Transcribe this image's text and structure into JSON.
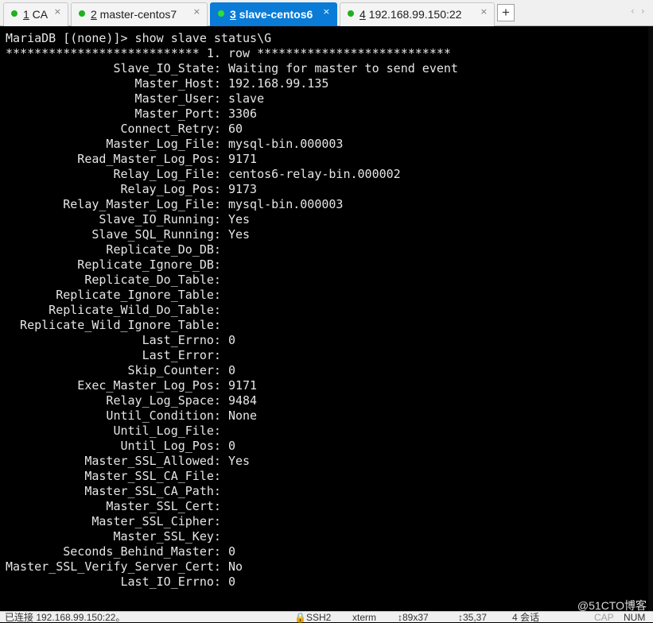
{
  "tabs": [
    {
      "num": "1",
      "title": " CA",
      "active": false
    },
    {
      "num": "2",
      "title": " master-centos7",
      "active": false
    },
    {
      "num": "3",
      "title": " slave-centos6",
      "active": true
    },
    {
      "num": "4",
      "title": " 192.168.99.150:22",
      "active": false
    }
  ],
  "tab_close": "×",
  "new_tab": "+",
  "nav": {
    "prev": "‹",
    "next": "›"
  },
  "terminal": {
    "prompt_line": "MariaDB [(none)]> show slave status\\G",
    "row_header": "*************************** 1. row ***************************",
    "fields": [
      {
        "key": "Slave_IO_State",
        "value": "Waiting for master to send event"
      },
      {
        "key": "Master_Host",
        "value": "192.168.99.135"
      },
      {
        "key": "Master_User",
        "value": "slave"
      },
      {
        "key": "Master_Port",
        "value": "3306"
      },
      {
        "key": "Connect_Retry",
        "value": "60"
      },
      {
        "key": "Master_Log_File",
        "value": "mysql-bin.000003"
      },
      {
        "key": "Read_Master_Log_Pos",
        "value": "9171"
      },
      {
        "key": "Relay_Log_File",
        "value": "centos6-relay-bin.000002"
      },
      {
        "key": "Relay_Log_Pos",
        "value": "9173"
      },
      {
        "key": "Relay_Master_Log_File",
        "value": "mysql-bin.000003"
      },
      {
        "key": "Slave_IO_Running",
        "value": "Yes"
      },
      {
        "key": "Slave_SQL_Running",
        "value": "Yes"
      },
      {
        "key": "Replicate_Do_DB",
        "value": ""
      },
      {
        "key": "Replicate_Ignore_DB",
        "value": ""
      },
      {
        "key": "Replicate_Do_Table",
        "value": ""
      },
      {
        "key": "Replicate_Ignore_Table",
        "value": ""
      },
      {
        "key": "Replicate_Wild_Do_Table",
        "value": ""
      },
      {
        "key": "Replicate_Wild_Ignore_Table",
        "value": ""
      },
      {
        "key": "Last_Errno",
        "value": "0"
      },
      {
        "key": "Last_Error",
        "value": ""
      },
      {
        "key": "Skip_Counter",
        "value": "0"
      },
      {
        "key": "Exec_Master_Log_Pos",
        "value": "9171"
      },
      {
        "key": "Relay_Log_Space",
        "value": "9484"
      },
      {
        "key": "Until_Condition",
        "value": "None"
      },
      {
        "key": "Until_Log_File",
        "value": ""
      },
      {
        "key": "Until_Log_Pos",
        "value": "0"
      },
      {
        "key": "Master_SSL_Allowed",
        "value": "Yes"
      },
      {
        "key": "Master_SSL_CA_File",
        "value": ""
      },
      {
        "key": "Master_SSL_CA_Path",
        "value": ""
      },
      {
        "key": "Master_SSL_Cert",
        "value": ""
      },
      {
        "key": "Master_SSL_Cipher",
        "value": ""
      },
      {
        "key": "Master_SSL_Key",
        "value": ""
      },
      {
        "key": "Seconds_Behind_Master",
        "value": "0"
      },
      {
        "key": "Master_SSL_Verify_Server_Cert",
        "value": "No"
      },
      {
        "key": "Last_IO_Errno",
        "value": "0"
      }
    ]
  },
  "statusbar": {
    "connection": "已连接 192.168.99.150:22。",
    "protocol": "SSH2",
    "term_type": "xterm",
    "size": "89x37",
    "cursor": "35,37",
    "sessions": "4 会话",
    "cap": "CAP",
    "num": "NUM"
  },
  "watermark": "@51CTO博客",
  "colors": {
    "active_tab": "#0a7bd6",
    "dot": "#1db21d",
    "terminal_bg": "#000000",
    "terminal_fg": "#e6e6e6"
  }
}
